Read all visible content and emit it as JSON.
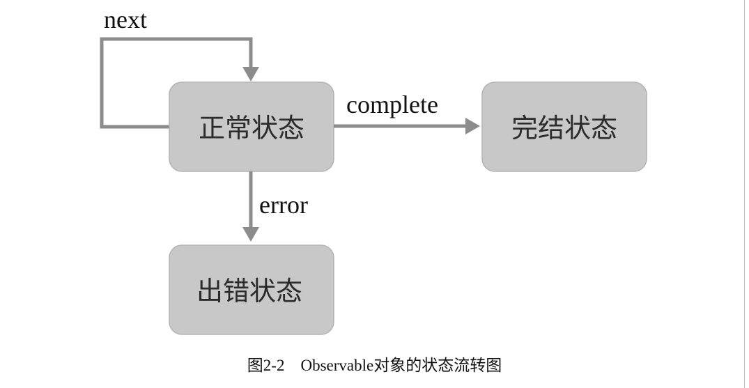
{
  "diagram": {
    "states": {
      "normal": "正常状态",
      "complete": "完结状态",
      "error": "出错状态"
    },
    "edges": {
      "next": "next",
      "complete": "complete",
      "error": "error"
    }
  },
  "figure": {
    "number": "图2-2",
    "title": "Observable对象的状态流转图"
  },
  "colors": {
    "box_fill": "#c8c8c8",
    "arrow": "#8c8c8c",
    "text": "#111111"
  }
}
